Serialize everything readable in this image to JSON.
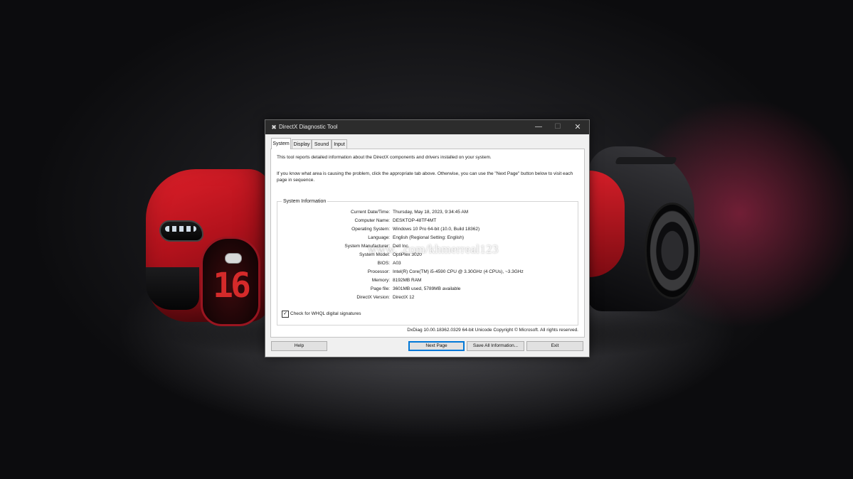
{
  "window": {
    "title": "DirectX Diagnostic Tool",
    "icon": "directx-icon",
    "controls": {
      "minimize": "—",
      "maximize": "☐",
      "close": "✕"
    }
  },
  "tabs": [
    {
      "label": "System",
      "active": true
    },
    {
      "label": "Display",
      "active": false
    },
    {
      "label": "Sound",
      "active": false
    },
    {
      "label": "Input",
      "active": false
    }
  ],
  "panel": {
    "intro1": "This tool reports detailed information about the DirectX components and drivers installed on your system.",
    "intro2": "If you know what area is causing the problem, click the appropriate tab above.  Otherwise, you can use the \"Next Page\" button below to visit each page in sequence.",
    "group_title": "System Information",
    "rows": [
      {
        "label": "Current Date/Time:",
        "value": "Thursday, May 18, 2023, 9:34:45 AM"
      },
      {
        "label": "Computer Name:",
        "value": "DESKTOP-48TF4MT"
      },
      {
        "label": "Operating System:",
        "value": "Windows 10 Pro 64-bit (10.0, Build 18362)"
      },
      {
        "label": "Language:",
        "value": "English (Regional Setting: English)"
      },
      {
        "label": "System Manufacturer:",
        "value": "Dell Inc."
      },
      {
        "label": "System Model:",
        "value": "OptiPlex 3020"
      },
      {
        "label": "BIOS:",
        "value": "A03"
      },
      {
        "label": "Processor:",
        "value": "Intel(R) Core(TM) i5-4590 CPU @ 3.30GHz (4 CPUs), ~3.3GHz"
      },
      {
        "label": "Memory:",
        "value": "8192MB RAM"
      },
      {
        "label": "Page file:",
        "value": "3601MB used, 5789MB available"
      },
      {
        "label": "DirectX Version:",
        "value": "DirectX 12"
      }
    ],
    "checkbox": {
      "label": "Check for WHQL digital signatures",
      "checked": true,
      "mark": "✓"
    },
    "footer": "DxDiag 10.00.18362.0329 64-bit Unicode  Copyright © Microsoft. All rights reserved."
  },
  "buttons": {
    "help": "Help",
    "next": "Next Page",
    "save": "Save All Information...",
    "exit": "Exit"
  },
  "wallpaper": {
    "grille_number": "16",
    "watermark": "www.              .com/khmerreal123"
  },
  "colors": {
    "titlebar": "#2c2c2c",
    "window_bg": "#f0f0f0",
    "default_button_border": "#0078d7",
    "car_red": "#d21e28"
  }
}
